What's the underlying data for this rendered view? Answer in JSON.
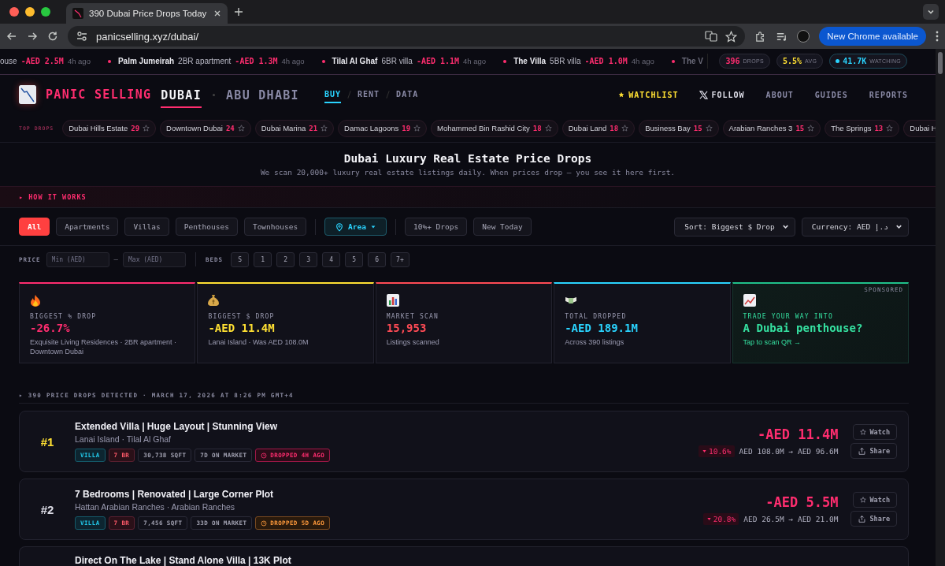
{
  "browser": {
    "tab_title": "390 Dubai Price Drops Today",
    "url": "panicselling.xyz/dubai/",
    "update_button": "New Chrome available"
  },
  "ticker": {
    "items": [
      {
        "type": "ouse",
        "drop": "-AED 2.5M",
        "time": "4h ago"
      },
      {
        "place": "Palm Jumeirah",
        "type": "2BR apartment",
        "drop": "-AED 1.3M",
        "time": "4h ago"
      },
      {
        "place": "Tilal Al Ghaf",
        "type": "6BR villa",
        "drop": "-AED 1.1M",
        "time": "4h ago"
      },
      {
        "place": "The Villa",
        "type": "5BR villa",
        "drop": "-AED 1.0M",
        "time": "4h ago"
      },
      {
        "place": "The V"
      }
    ],
    "stats": [
      {
        "value": "396",
        "label": "DROPS",
        "color": "#ff2d6f",
        "live": false
      },
      {
        "value": "5.5%",
        "label": "AVG",
        "color": "#ffe033",
        "live": false
      },
      {
        "value": "41.7K",
        "label": "WATCHING",
        "color": "#2ad4ff",
        "live": true
      }
    ]
  },
  "header": {
    "brand": "PANIC SELLING",
    "cities": [
      {
        "label": "DUBAI",
        "selected": true
      },
      {
        "label": "ABU DHABI",
        "selected": false
      }
    ],
    "modes": [
      {
        "label": "BUY",
        "selected": true
      },
      {
        "label": "RENT",
        "selected": false
      },
      {
        "label": "DATA",
        "selected": false
      }
    ],
    "nav": [
      {
        "label": "WATCHLIST",
        "kind": "watchlist"
      },
      {
        "label": "FOLLOW",
        "kind": "follow"
      },
      {
        "label": "ABOUT",
        "kind": "link"
      },
      {
        "label": "GUIDES",
        "kind": "link"
      },
      {
        "label": "REPORTS",
        "kind": "link"
      }
    ]
  },
  "top_drops": {
    "label": "TOP DROPS",
    "chips": [
      {
        "name": "Dubai Hills Estate",
        "count": "29"
      },
      {
        "name": "Downtown Dubai",
        "count": "24"
      },
      {
        "name": "Dubai Marina",
        "count": "21"
      },
      {
        "name": "Damac Lagoons",
        "count": "19"
      },
      {
        "name": "Mohammed Bin Rashid City",
        "count": "18"
      },
      {
        "name": "Dubai Land",
        "count": "18"
      },
      {
        "name": "Business Bay",
        "count": "15"
      },
      {
        "name": "Arabian Ranches 3",
        "count": "15"
      },
      {
        "name": "The Springs",
        "count": "13"
      },
      {
        "name": "Dubai H"
      }
    ]
  },
  "hero": {
    "title": "Dubai Luxury Real Estate Price Drops",
    "subtitle": "We scan 20,000+ luxury real estate listings daily. When prices drop — you see it here first."
  },
  "how_it_works": "▸ HOW IT WORKS",
  "filters": {
    "types": [
      {
        "label": "All",
        "selected": true
      },
      {
        "label": "Apartments",
        "selected": false
      },
      {
        "label": "Villas",
        "selected": false
      },
      {
        "label": "Penthouses",
        "selected": false
      },
      {
        "label": "Townhouses",
        "selected": false
      }
    ],
    "area": "Area",
    "quick": [
      {
        "label": "10%+ Drops",
        "selected": false
      },
      {
        "label": "New Today",
        "selected": false
      }
    ],
    "sort": "Sort: Biggest $ Drop",
    "currency": "Currency: AED د.إ"
  },
  "price_filter": {
    "label": "PRICE",
    "min_placeholder": "Min (AED)",
    "separator": "–",
    "max_placeholder": "Max (AED)"
  },
  "beds_filter": {
    "label": "BEDS",
    "options": [
      {
        "label": "S",
        "selected": false
      },
      {
        "label": "1",
        "selected": false
      },
      {
        "label": "2",
        "selected": false
      },
      {
        "label": "3",
        "selected": false
      },
      {
        "label": "4",
        "selected": false
      },
      {
        "label": "5",
        "selected": false
      },
      {
        "label": "6",
        "selected": false
      },
      {
        "label": "7+",
        "selected": false
      }
    ]
  },
  "stats": [
    {
      "kind": "percent_drop",
      "label": "BIGGEST % DROP",
      "value": "-26.7%",
      "note": "Exquisite Living Residences · 2BR apartment · Downtown Dubai",
      "color": "#ff2d6f"
    },
    {
      "kind": "amount_drop",
      "label": "BIGGEST $ DROP",
      "value": "-AED 11.4M",
      "note": "Lanai Island · Was AED 108.0M",
      "color": "#ffe033"
    },
    {
      "kind": "scan",
      "label": "MARKET SCAN",
      "value": "15,953",
      "note": "Listings scanned",
      "color": "#ff4b55"
    },
    {
      "kind": "total",
      "label": "TOTAL DROPPED",
      "value": "-AED 189.1M",
      "note": "Across 390 listings",
      "color": "#2ad4ff"
    }
  ],
  "sponsored": {
    "badge": "SPONSORED",
    "label": "TRADE YOUR WAY INTO",
    "title": "A Dubai penthouse?",
    "note": "Tap to scan QR →"
  },
  "results": {
    "summary": "▸ 390 PRICE DROPS DETECTED · MARCH 17, 2026 AT 8:26 PM GMT+4"
  },
  "listings": [
    {
      "rank": "#1",
      "highlight": true,
      "title": "Extended Villa | Huge Layout | Stunning View",
      "location": "Lanai Island · Tilal Al Ghaf",
      "tags": [
        {
          "text": "VILLA",
          "kind": "type"
        },
        {
          "text": "7 BR",
          "kind": "beds"
        },
        {
          "text": "30,738 SQFT",
          "kind": "plain"
        },
        {
          "text": "7D ON MARKET",
          "kind": "plain"
        },
        {
          "text": "DROPPED 4H AGO",
          "kind": "recent"
        }
      ],
      "drop": "-AED 11.4M",
      "percent": "10.6%",
      "prices": "AED 108.0M → AED 96.6M",
      "watch": "Watch",
      "share": "Share"
    },
    {
      "rank": "#2",
      "highlight": false,
      "title": "7 Bedrooms | Renovated | Large Corner Plot",
      "location": "Hattan Arabian Ranches · Arabian Ranches",
      "tags": [
        {
          "text": "VILLA",
          "kind": "type"
        },
        {
          "text": "7 BR",
          "kind": "beds"
        },
        {
          "text": "7,456 SQFT",
          "kind": "plain"
        },
        {
          "text": "33D ON MARKET",
          "kind": "plain"
        },
        {
          "text": "DROPPED 5D AGO",
          "kind": "older"
        }
      ],
      "drop": "-AED 5.5M",
      "percent": "20.8%",
      "prices": "AED 26.5M → AED 21.0M",
      "watch": "Watch",
      "share": "Share"
    },
    {
      "title": "Direct On The Lake | Stand Alone Villa | 13K Plot"
    }
  ]
}
